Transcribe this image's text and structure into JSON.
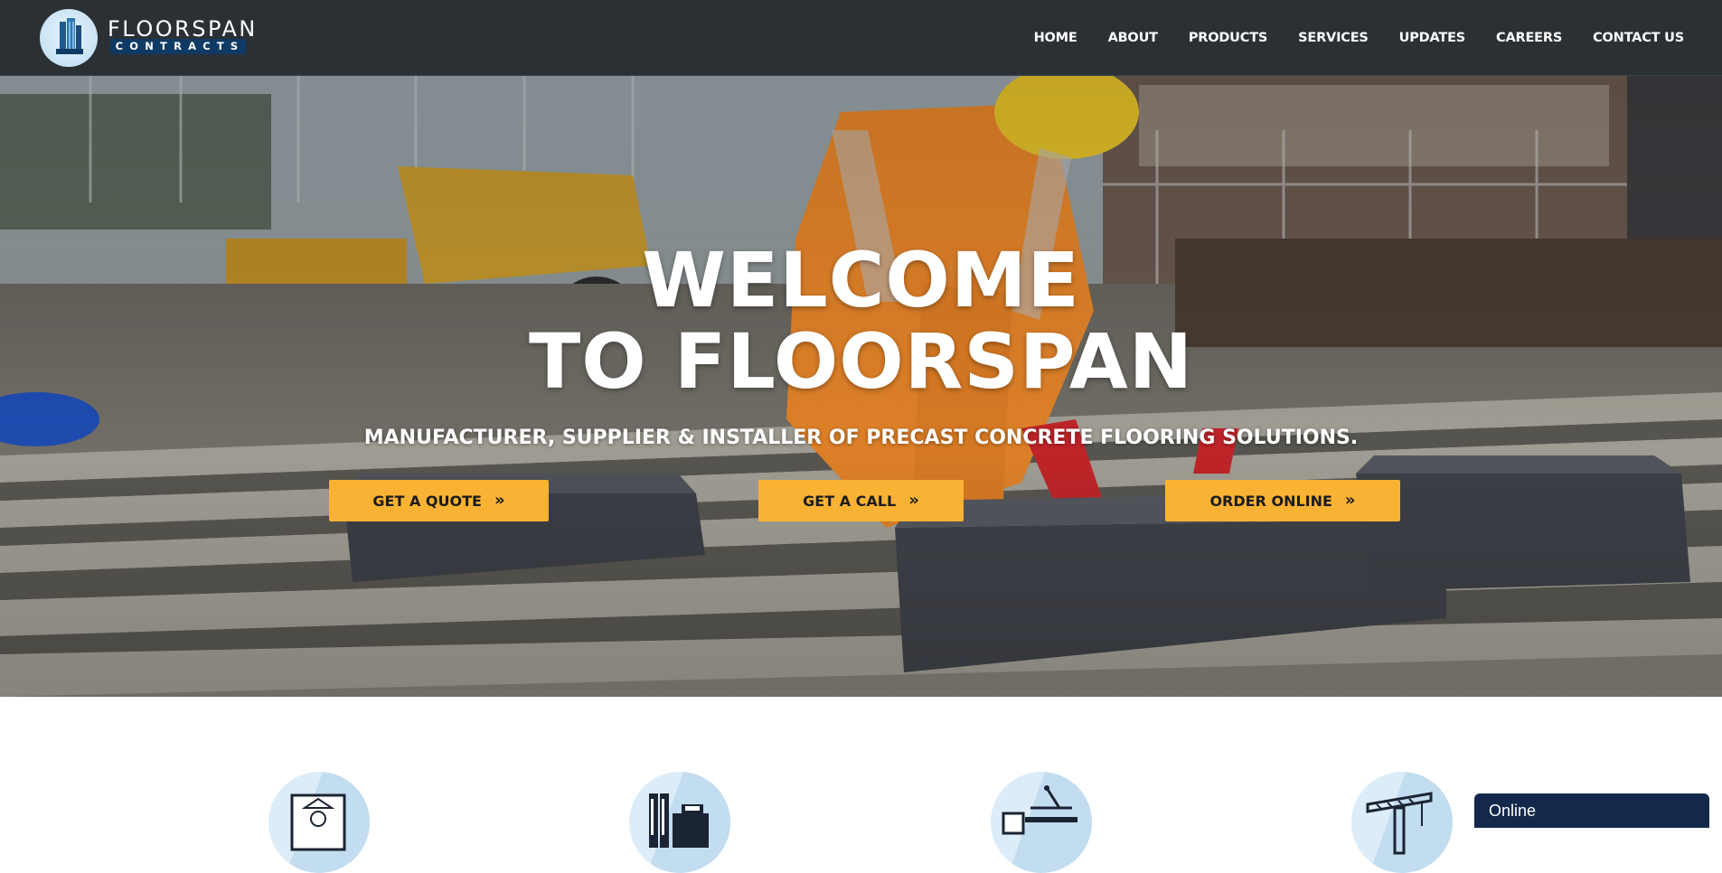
{
  "brand": {
    "name": "FLOORSPAN",
    "tagline": "CONTRACTS",
    "colors": {
      "header_bg": "#2b3035",
      "accent": "#f9b233",
      "navy": "#0f3a63",
      "chat_bg": "#13294b"
    }
  },
  "nav": {
    "items": [
      {
        "label": "HOME"
      },
      {
        "label": "ABOUT"
      },
      {
        "label": "PRODUCTS"
      },
      {
        "label": "SERVICES"
      },
      {
        "label": "UPDATES"
      },
      {
        "label": "CAREERS"
      },
      {
        "label": "CONTACT US"
      }
    ]
  },
  "hero": {
    "title_line1": "WELCOME",
    "title_line2": "TO FLOORSPAN",
    "subtitle": "MANUFACTURER, SUPPLIER & INSTALLER OF PRECAST CONCRETE FLOORING SOLUTIONS.",
    "buttons": {
      "quote": "GET A QUOTE",
      "call": "GET A CALL",
      "order": "ORDER ONLINE",
      "icon": "double-chevron-right-icon"
    }
  },
  "features": {
    "icons": [
      "house-blueprint-icon",
      "factory-icon",
      "delivery-truck-icon",
      "crane-icon"
    ]
  },
  "chat": {
    "status": "Online"
  }
}
